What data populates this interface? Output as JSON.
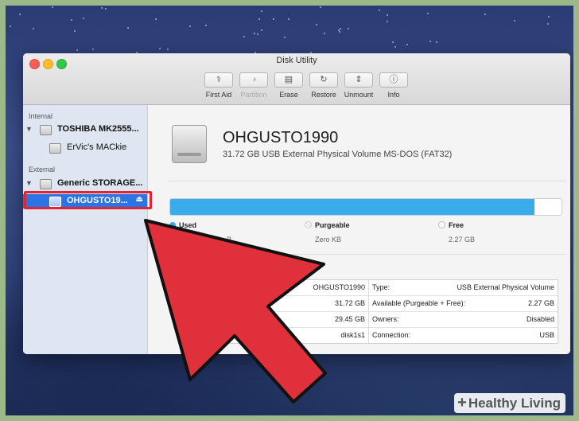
{
  "window": {
    "title": "Disk Utility"
  },
  "toolbar": [
    {
      "label": "First Aid",
      "icon": "stethoscope-icon",
      "glyph": "⚕",
      "enabled": true
    },
    {
      "label": "Partition",
      "icon": "partition-icon",
      "glyph": "◑",
      "enabled": false
    },
    {
      "label": "Erase",
      "icon": "erase-icon",
      "glyph": "▤",
      "enabled": true
    },
    {
      "label": "Restore",
      "icon": "restore-icon",
      "glyph": "↻",
      "enabled": true
    },
    {
      "label": "Unmount",
      "icon": "unmount-icon",
      "glyph": "⇕",
      "enabled": true
    },
    {
      "label": "Info",
      "icon": "info-icon",
      "glyph": "ⓘ",
      "enabled": true
    }
  ],
  "sidebar": {
    "internal_label": "Internal",
    "external_label": "External",
    "internal": [
      {
        "label": "TOSHIBA MK2555...",
        "level": 0
      },
      {
        "label": "ErVic's MACkie",
        "level": 1
      }
    ],
    "external": [
      {
        "label": "Generic STORAGE...",
        "level": 0
      },
      {
        "label": "OHGUSTO19...",
        "level": 1,
        "selected": true
      }
    ]
  },
  "volume": {
    "name": "OHGUSTO1990",
    "description": "31.72 GB USB External Physical Volume MS-DOS (FAT32)"
  },
  "usage": {
    "used_fraction": 0.93,
    "legend": [
      {
        "label": "Used",
        "value": "B",
        "color": "#3aacec"
      },
      {
        "label": "Purgeable",
        "value": "Zero KB",
        "color": "#e0e0e0"
      },
      {
        "label": "Free",
        "value": "2.27 GB",
        "color": "#ffffff"
      }
    ]
  },
  "info_left": [
    {
      "key": "",
      "value": "OHGUSTO1990"
    },
    {
      "key": "",
      "value": "31.72 GB"
    },
    {
      "key": "",
      "value": "29.45 GB"
    },
    {
      "key": "D",
      "value": "disk1s1"
    }
  ],
  "info_right": [
    {
      "key": "Type:",
      "value": "USB External Physical Volume"
    },
    {
      "key": "Available (Purgeable + Free):",
      "value": "2.27 GB"
    },
    {
      "key": "Owners:",
      "value": "Disabled"
    },
    {
      "key": "Connection:",
      "value": "USB"
    }
  ],
  "colors": {
    "accent": "#2b74e4",
    "highlight": "#e1242f",
    "arrow": "#e0303c"
  },
  "watermark": {
    "plus": "+",
    "text": "Healthy Living"
  }
}
